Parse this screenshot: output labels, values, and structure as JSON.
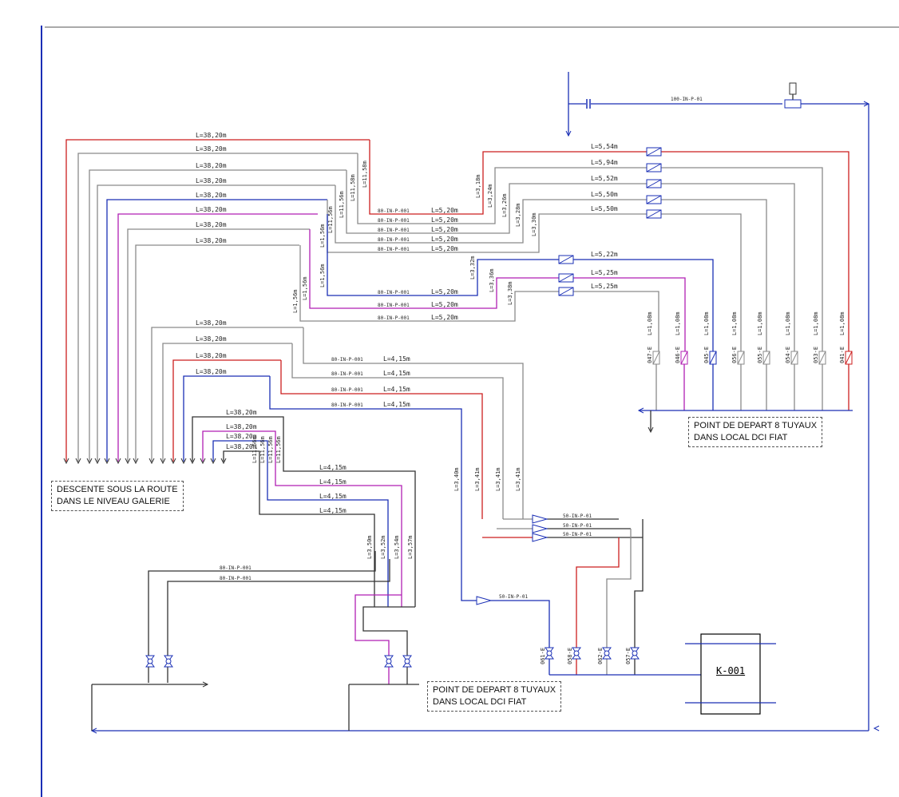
{
  "notes": {
    "left": [
      "DESCENTE SOUS LA ROUTE",
      "DANS LE NIVEAU GALERIE"
    ],
    "right": [
      "POINT DE DEPART 8 TUYAUX",
      "DANS LOCAL DCI FIAT"
    ],
    "bottom": [
      "POINT DE DEPART 8 TUYAUX",
      "DANS LOCAL DCI FIAT"
    ]
  },
  "tank": {
    "label": "K-001"
  },
  "colors": {
    "red": "#cc1f1f",
    "blue": "#1a2fb5",
    "magenta": "#b01fb3",
    "gray": "#8a8a8a",
    "dark": "#333333",
    "frame": "#1a2fb5"
  },
  "main_line_label": "100-IN-P-01",
  "upper_group": {
    "header_lengths": [
      "L=38,20m",
      "L=38,20m",
      "L=38,20m",
      "L=38,20m",
      "L=38,20m",
      "L=38,20m",
      "L=38,20m",
      "L=38,20m"
    ],
    "right_lengths": [
      "L=5,54m",
      "L=5,94m",
      "L=5,52m",
      "L=5,50m",
      "L=5,50m",
      "L=5,22m",
      "L=5,25m",
      "L=5,25m"
    ],
    "mid_lengths": [
      "L=5,20m",
      "L=5,20m",
      "L=5,20m",
      "L=5,20m",
      "L=5,20m",
      "L=5,20m",
      "L=5,20m",
      "L=5,20m"
    ],
    "line_tags": [
      "80-IN-P-001",
      "80-IN-P-001",
      "80-IN-P-001",
      "80-IN-P-001",
      "80-IN-P-001",
      "80-IN-P-001",
      "80-IN-P-001",
      "80-IN-P-001"
    ],
    "riser_lengths": [
      "L=3,18m",
      "L=3,24m",
      "L=3,26m",
      "L=3,28m",
      "L=3,30m",
      "L=3,32m",
      "L=3,36m",
      "L=3,38m"
    ],
    "left_riser_lengths": [
      "L=11,58m",
      "L=11,58m",
      "L=11,56m",
      "L=11,56m",
      "L=1,56m",
      "L=1,56m",
      "L=1,56m",
      "L=1,56m"
    ],
    "valve_tags": [
      "047-E",
      "046-E",
      "045-E",
      "056-E",
      "055-E",
      "054-E",
      "053-E",
      "041-E"
    ],
    "drop_lengths": [
      "L=1,08m",
      "L=1,08m",
      "L=1,08m",
      "L=1,08m",
      "L=1,08m",
      "L=1,08m",
      "L=1,08m",
      "L=1,08m"
    ]
  },
  "lower_group": {
    "header_lengths": [
      "L=38,20m",
      "L=38,20m",
      "L=38,20m",
      "L=38,20m",
      "L=38,20m",
      "L=38,20m",
      "L=38,20m",
      "L=38,20m"
    ],
    "mid_lengths": [
      "L=4,15m",
      "L=4,15m",
      "L=4,15m",
      "L=4,15m",
      "L=4,15m",
      "L=4,15m",
      "L=4,15m",
      "L=4,15m"
    ],
    "line_tags": [
      "80-IN-P-001",
      "80-IN-P-001",
      "80-IN-P-001",
      "80-IN-P-001",
      "80-IN-P-001",
      "80-IN-P-001"
    ],
    "riser_lengths": [
      "L=3,41m",
      "L=3,41m",
      "L=3,41m",
      "L=3,40m"
    ],
    "left_riser_lengths": [
      "L=11,56m",
      "L=11,56m",
      "L=11,56m",
      "L=11,56m"
    ],
    "bottom_risers": [
      "L=3,57m",
      "L=3,54m",
      "L=3,52m",
      "L=3,50m"
    ],
    "small_tags": [
      "50-IN-P-01",
      "50-IN-P-01",
      "50-IN-P-01",
      "50-IN-P-01"
    ],
    "valve_tags": [
      "061-E",
      "058-E",
      "062-E",
      "057-E"
    ]
  }
}
